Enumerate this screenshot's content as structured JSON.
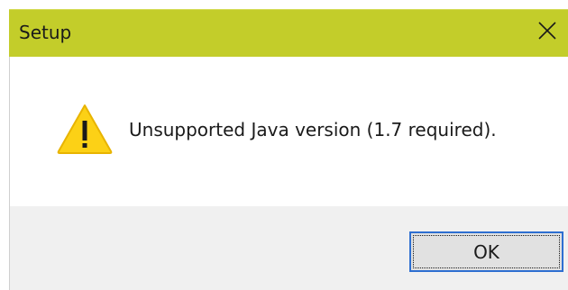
{
  "window": {
    "title": "Setup",
    "close_icon": "close-icon"
  },
  "content": {
    "icon": "warning-icon",
    "message": "Unsupported Java version (1.7 required)."
  },
  "footer": {
    "ok_label": "OK"
  },
  "colors": {
    "titlebar": "#c3cd2a",
    "footer": "#f0f0f0",
    "button_border": "#2e6fd1",
    "warning_fill": "#fcd116"
  }
}
